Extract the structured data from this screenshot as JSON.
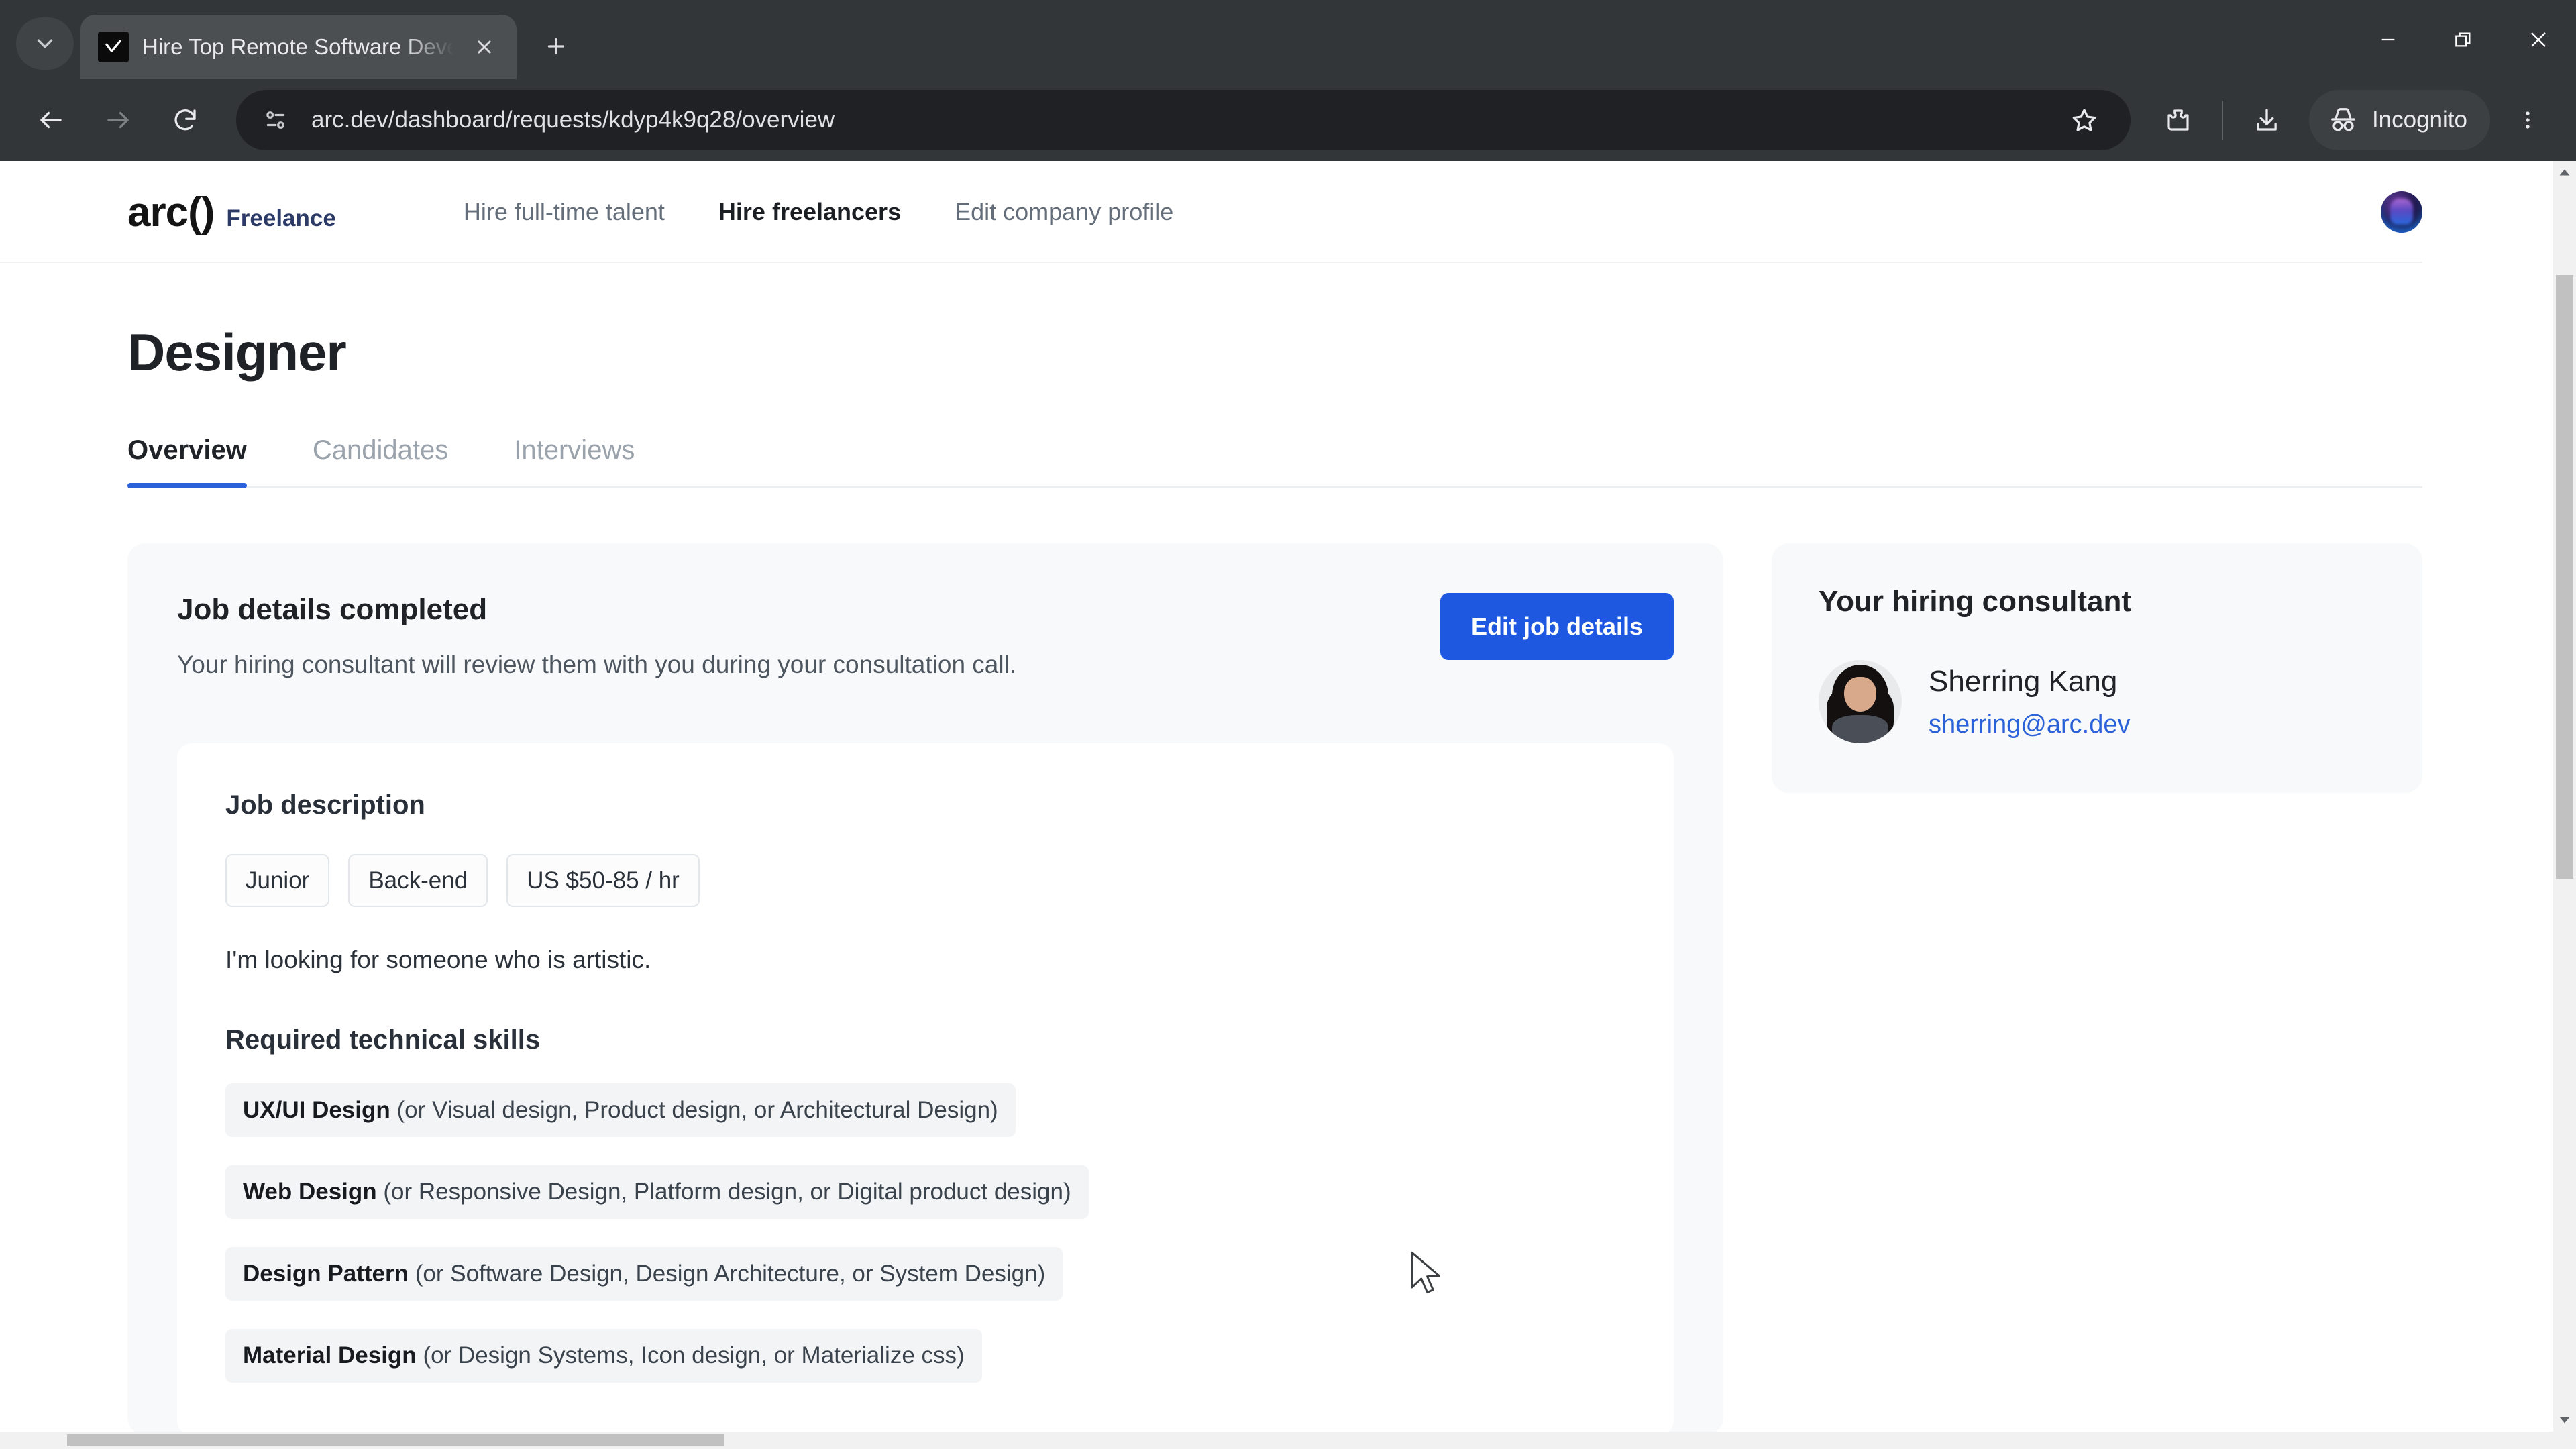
{
  "browser": {
    "tab": {
      "title": "Hire Top Remote Software Deve",
      "favicon_name": "arc-favicon",
      "close_label": "Close tab"
    },
    "tab_search_label": "Search tabs",
    "new_tab_label": "New Tab",
    "window_controls": {
      "minimize": "Minimize",
      "maximize": "Restore",
      "close": "Close"
    },
    "toolbar": {
      "back": "Back",
      "forward": "Forward",
      "reload": "Reload",
      "site_info": "View site information",
      "url": "arc.dev/dashboard/requests/kdyp4k9q28/overview",
      "bookmark": "Bookmark this tab",
      "extensions": "Extensions",
      "downloads": "Downloads",
      "incognito_label": "Incognito",
      "menu": "Customize and control Google Chrome"
    }
  },
  "site": {
    "brand": {
      "logo": "arc()",
      "suffix": "Freelance"
    },
    "nav": [
      {
        "label": "Hire full-time talent",
        "active": false
      },
      {
        "label": "Hire freelancers",
        "active": true
      },
      {
        "label": "Edit company profile",
        "active": false
      }
    ],
    "avatar_label": "Account avatar"
  },
  "page": {
    "title": "Designer",
    "tabs": [
      {
        "label": "Overview",
        "active": true
      },
      {
        "label": "Candidates",
        "active": false
      },
      {
        "label": "Interviews",
        "active": false
      }
    ]
  },
  "job_details": {
    "title": "Job details completed",
    "subtitle": "Your hiring consultant will review them with you during your consultation call.",
    "edit_button": "Edit job details",
    "description": {
      "section_title": "Job description",
      "chips": [
        "Junior",
        "Back-end",
        "US $50-85 / hr"
      ],
      "text": "I'm looking for someone who is artistic."
    },
    "skills": {
      "section_title": "Required technical skills",
      "items": [
        {
          "name": "UX/UI Design",
          "alternatives": "(or Visual design, Product design, or Architectural Design)"
        },
        {
          "name": "Web Design",
          "alternatives": "(or Responsive Design, Platform design, or Digital product design)"
        },
        {
          "name": "Design Pattern",
          "alternatives": "(or Software Design, Design Architecture, or System Design)"
        },
        {
          "name": "Material Design",
          "alternatives": "(or Design Systems, Icon design, or Materialize css)"
        }
      ]
    }
  },
  "consultant_panel": {
    "title": "Your hiring consultant",
    "name": "Sherring Kang",
    "email": "sherring@arc.dev",
    "photo_label": "Sherring Kang photo"
  },
  "colors": {
    "accent": "#1e58e0",
    "tab_underline": "#2b62d9",
    "link": "#2b62d9",
    "card_bg": "#f8f9fa",
    "chrome_bg": "#323639",
    "omnibox_bg": "#202124"
  }
}
